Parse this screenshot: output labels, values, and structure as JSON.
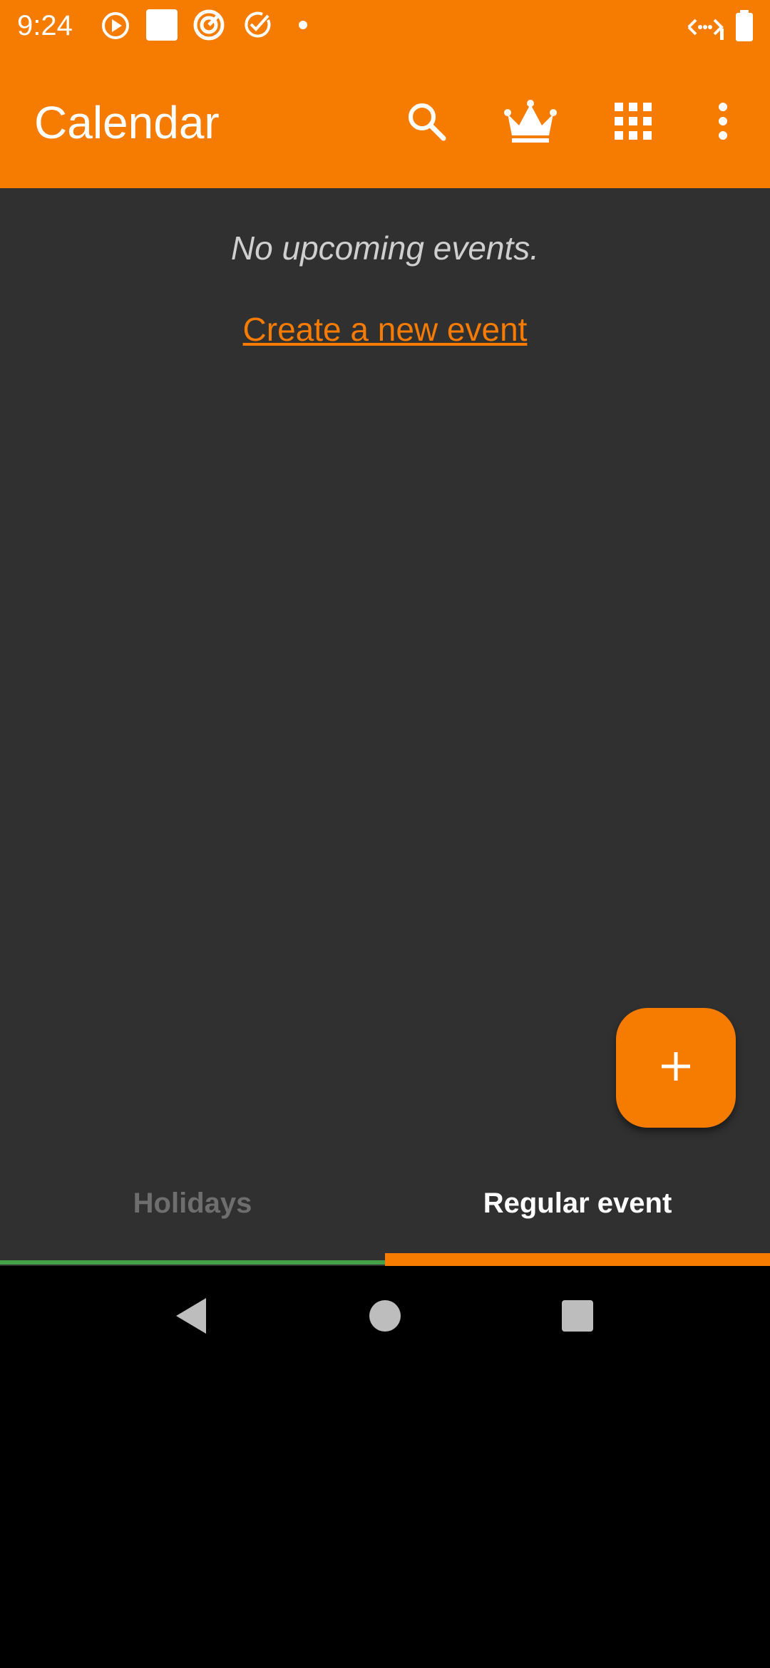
{
  "status_bar": {
    "time": "9:24",
    "icons": [
      "play-circle-icon",
      "square-notification-icon",
      "target-icon",
      "check-circle-icon",
      "dot-icon",
      "signal-icon",
      "battery-icon"
    ]
  },
  "app_bar": {
    "title": "Calendar",
    "actions": [
      "search-icon",
      "crown-icon",
      "apps-grid-icon",
      "more-vert-icon"
    ]
  },
  "content": {
    "empty_message": "No upcoming events.",
    "create_link": "Create a new event"
  },
  "fab": {
    "icon": "plus-icon"
  },
  "tabs": [
    {
      "label": "Holidays",
      "selected": false
    },
    {
      "label": "Regular event",
      "selected": true
    }
  ],
  "nav_bar": {
    "buttons": [
      "back-icon",
      "home-icon",
      "recents-icon"
    ]
  },
  "colors": {
    "accent": "#F57C00",
    "background": "#303030",
    "holiday_indicator": "#43A047"
  }
}
